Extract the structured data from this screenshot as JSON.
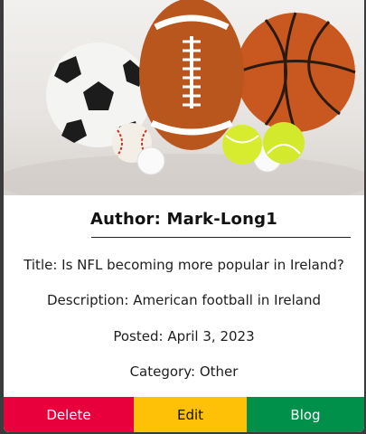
{
  "post": {
    "image_alt": "Sports balls: soccer ball, American football, basketball, baseball, tennis balls, golf balls",
    "author": "Author: Mark-Long1",
    "title": "Title: Is NFL becoming more popular in Ireland?",
    "description": "Description: American football in Ireland",
    "posted": "Posted: April 3, 2023",
    "category": "Category: Other"
  },
  "actions": {
    "delete_label": "Delete",
    "edit_label": "Edit",
    "blog_label": "Blog"
  },
  "colors": {
    "delete": "#e8003d",
    "edit": "#ffc107",
    "blog": "#00904a",
    "background": "#3b3b3d"
  }
}
